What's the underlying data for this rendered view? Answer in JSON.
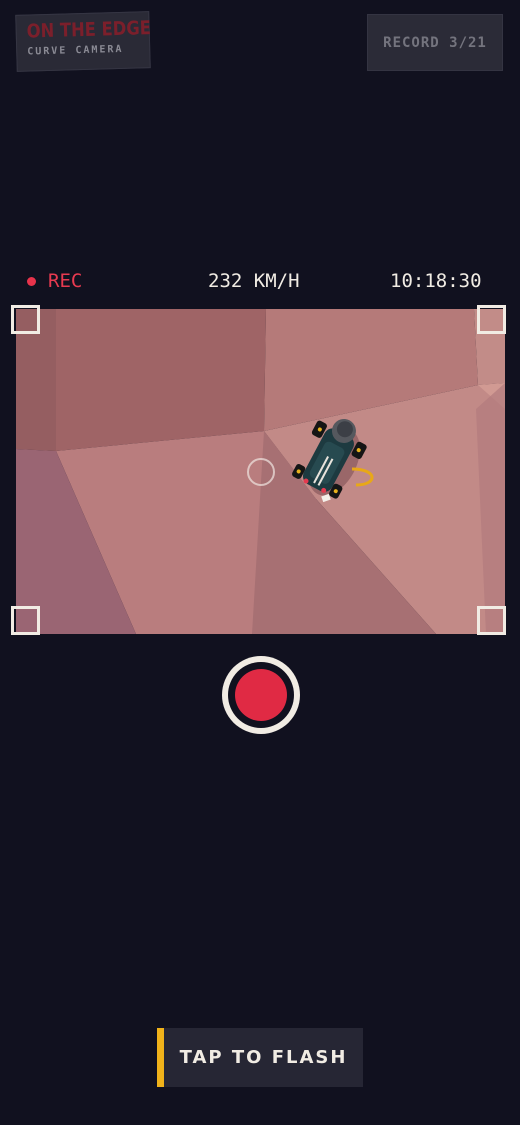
{
  "logo": {
    "title": "ON THE EDGE",
    "subtitle": "CURVE CAMERA"
  },
  "record_counter": {
    "label": "RECORD 3/21"
  },
  "hud": {
    "rec_label": "REC",
    "speed": "232 KM/H",
    "clock": "10:18:30"
  },
  "flash_button": {
    "label": "TAP TO FLASH"
  },
  "colors": {
    "background": "#11111f",
    "rec_red": "#e83a50",
    "record_button_red": "#e02a44",
    "flash_accent": "#f0b21a",
    "hud_text": "#f1ece4",
    "terrain_pink": "#c98a88"
  }
}
